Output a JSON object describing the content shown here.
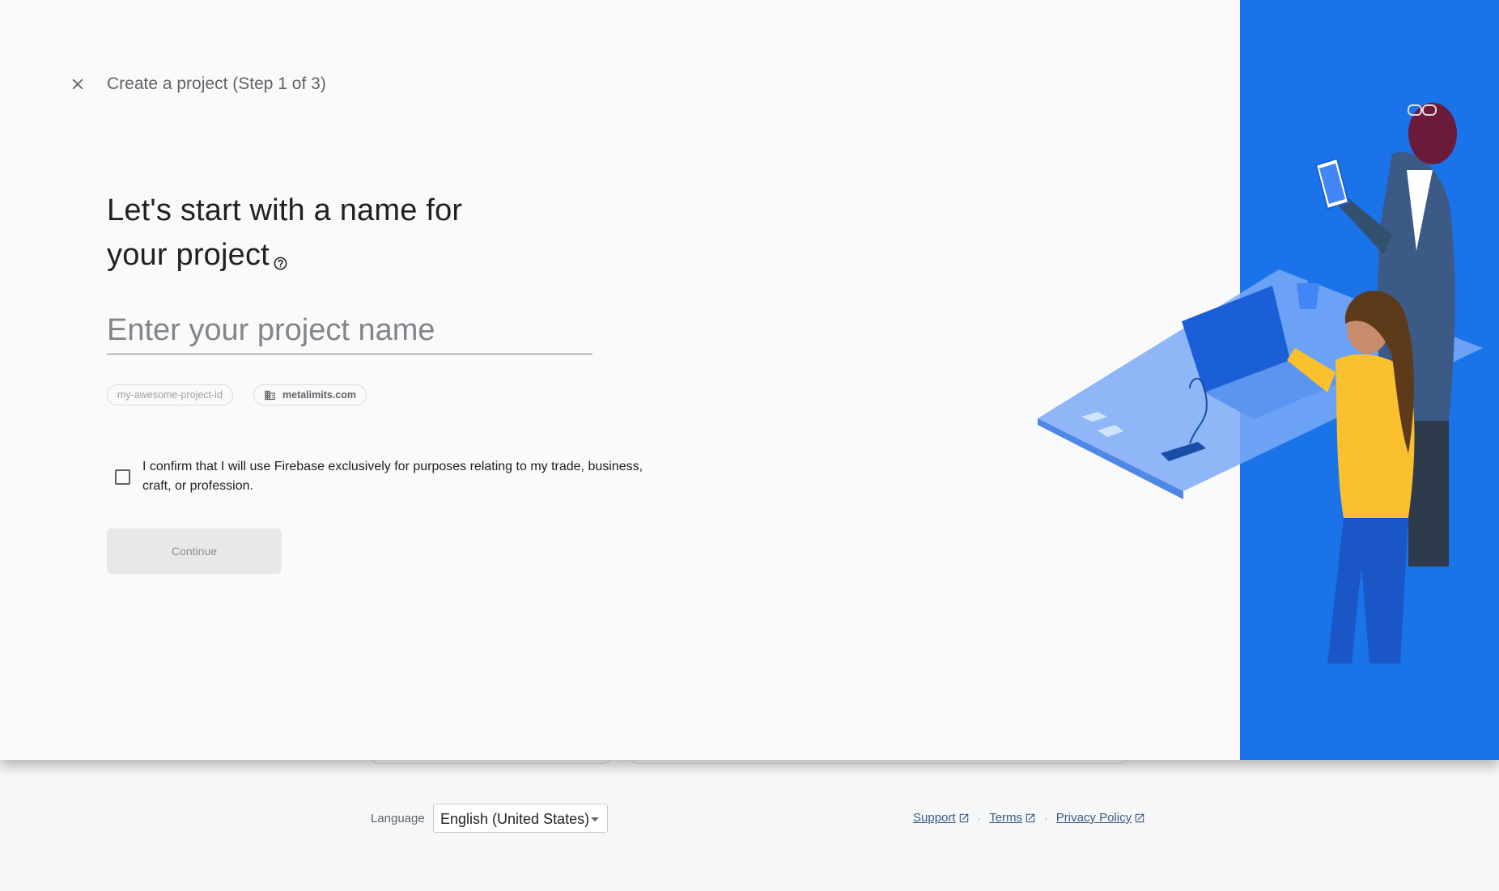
{
  "modal": {
    "step_title": "Create a project (Step 1 of 3)",
    "heading_line1": "Let's start with a name for",
    "heading_line2": "your project",
    "name_input_placeholder": "Enter your project name",
    "project_id_chip": "my-awesome-project-id",
    "organization_chip": "metalimits.com",
    "confirm_text": "I confirm that I will use Firebase exclusively for purposes relating to my trade, business, craft, or profession.",
    "confirm_checked": false,
    "continue_label": "Continue",
    "accent_color": "#1a73e8"
  },
  "footer": {
    "language_label": "Language",
    "language_value": "English (United States)",
    "links": [
      "Support",
      "Terms",
      "Privacy Policy"
    ],
    "separator": "·"
  },
  "icons": {
    "close": "close-icon",
    "help": "help-circle-icon",
    "organization": "building-icon",
    "external_link": "open-in-new-icon",
    "dropdown": "caret-down-icon"
  }
}
